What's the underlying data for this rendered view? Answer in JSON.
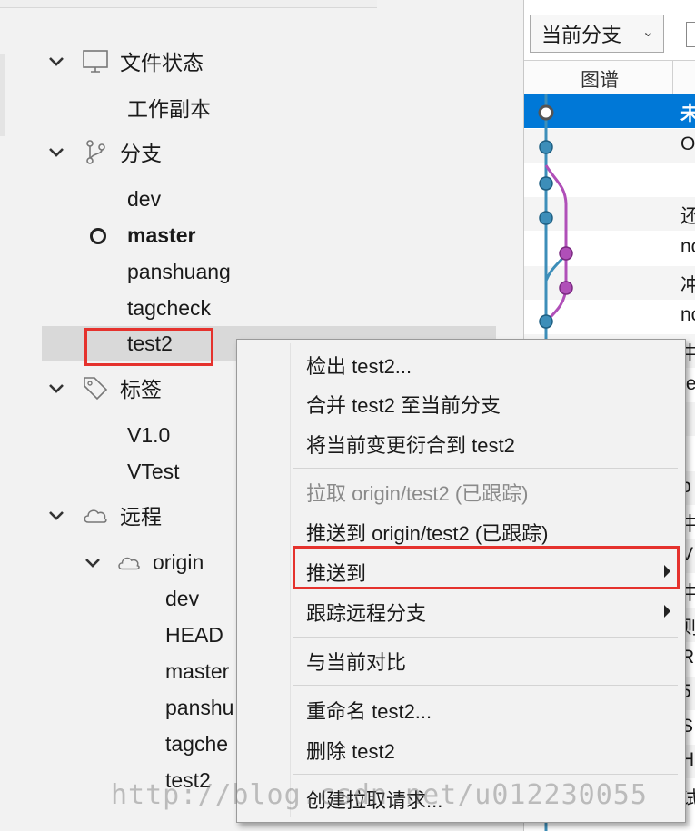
{
  "sidebar": {
    "file_status": {
      "header": "文件状态",
      "items": [
        "工作副本"
      ]
    },
    "branches": {
      "header": "分支",
      "items": [
        "dev",
        "master",
        "panshuang",
        "tagcheck",
        "test2"
      ],
      "current": "master",
      "selected": "test2"
    },
    "tags": {
      "header": "标签",
      "items": [
        "V1.0",
        "VTest"
      ]
    },
    "remotes": {
      "header": "远程",
      "remote_name": "origin",
      "items": [
        "dev",
        "HEAD",
        "master",
        "panshu",
        "tagche",
        "test2"
      ]
    }
  },
  "log_panel": {
    "branch_filter": "当前分支",
    "column_graph": "图谱",
    "rows": [
      "未",
      "O",
      "",
      "还",
      "nc",
      "冲",
      "nc",
      "中",
      "te",
      "",
      "",
      "p",
      "中",
      "V",
      "中",
      "则",
      "R",
      "5",
      "S",
      "H",
      "试"
    ]
  },
  "context_menu": {
    "items": [
      {
        "label": "检出 test2...",
        "enabled": true,
        "submenu": false
      },
      {
        "label": "合并 test2 至当前分支",
        "enabled": true,
        "submenu": false
      },
      {
        "label": "将当前变更衍合到 test2",
        "enabled": true,
        "submenu": false
      },
      {
        "label": "拉取 origin/test2 (已跟踪)",
        "enabled": false,
        "submenu": false
      },
      {
        "label": "推送到 origin/test2 (已跟踪)",
        "enabled": true,
        "submenu": false
      },
      {
        "label": "推送到",
        "enabled": true,
        "submenu": true,
        "highlighted": true
      },
      {
        "label": "跟踪远程分支",
        "enabled": true,
        "submenu": true
      },
      {
        "label": "与当前对比",
        "enabled": true,
        "submenu": false
      },
      {
        "label": "重命名 test2...",
        "enabled": true,
        "submenu": false
      },
      {
        "label": "删除 test2",
        "enabled": true,
        "submenu": false
      },
      {
        "label": "创建拉取请求...",
        "enabled": true,
        "submenu": false
      }
    ]
  },
  "watermark": "http://blog.csdn.net/u012230055",
  "colors": {
    "selection_blue": "#0078d7",
    "annotation_red": "#e5322d",
    "graph_blue": "#3d8eb9",
    "graph_purple": "#b04fb8"
  },
  "icons": [
    "chevron-down-icon",
    "monitor-icon",
    "branch-icon",
    "tag-icon",
    "cloud-icon",
    "submenu-arrow-icon"
  ]
}
